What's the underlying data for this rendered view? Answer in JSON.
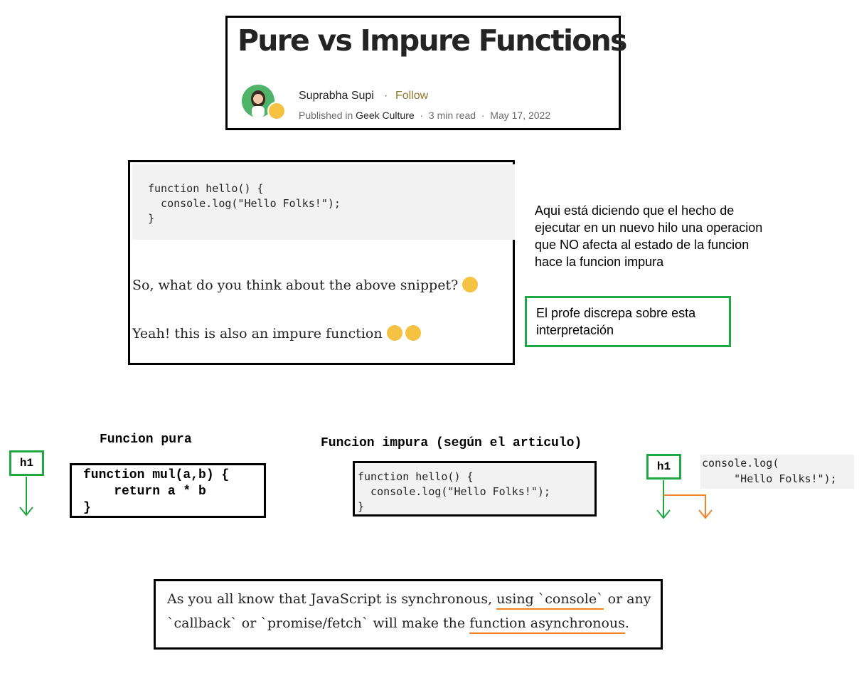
{
  "header": {
    "title": "Pure vs Impure Functions",
    "author": "Suprabha Supi",
    "separator": "·",
    "follow_label": "Follow",
    "published_prefix": "Published in",
    "publication": "Geek Culture",
    "read_time": "3 min read",
    "date": "May 17, 2022"
  },
  "snippet": {
    "code": "function hello() {\n  console.log(\"Hello Folks!\");\n}",
    "question": "So, what do you think about the above snippet?",
    "answer": "Yeah! this is also an impure function"
  },
  "notes": {
    "note_1": "Aqui está diciendo que el hecho de ejecutar en un nuevo hilo una operacion que NO afecta al estado de la funcion hace la funcion impura",
    "note_2": "El profe discrepa sobre esta interpretación"
  },
  "diagram": {
    "pure_label": "Funcion pura",
    "impure_label": "Funcion impura (según el articulo)",
    "h1_left": "h1",
    "h1_right": "h1",
    "pure_code": "function mul(a,b) {\n    return a * b\n}",
    "impure_code": "function hello() {\n  console.log(\"Hello Folks!\");\n}",
    "console_code": "console.log(\n     \"Hello Folks!\");"
  },
  "quote": {
    "part_1": "As you all know that JavaScript is synchronous, ",
    "underlined_1": "using `console`",
    "part_2": " or any `callback` or `promise/fetch` will make the ",
    "underlined_2": "function asynchronous",
    "part_3": "."
  },
  "colors": {
    "green": "#22a745",
    "orange": "#f0832a",
    "follow": "#8a7a2e"
  }
}
